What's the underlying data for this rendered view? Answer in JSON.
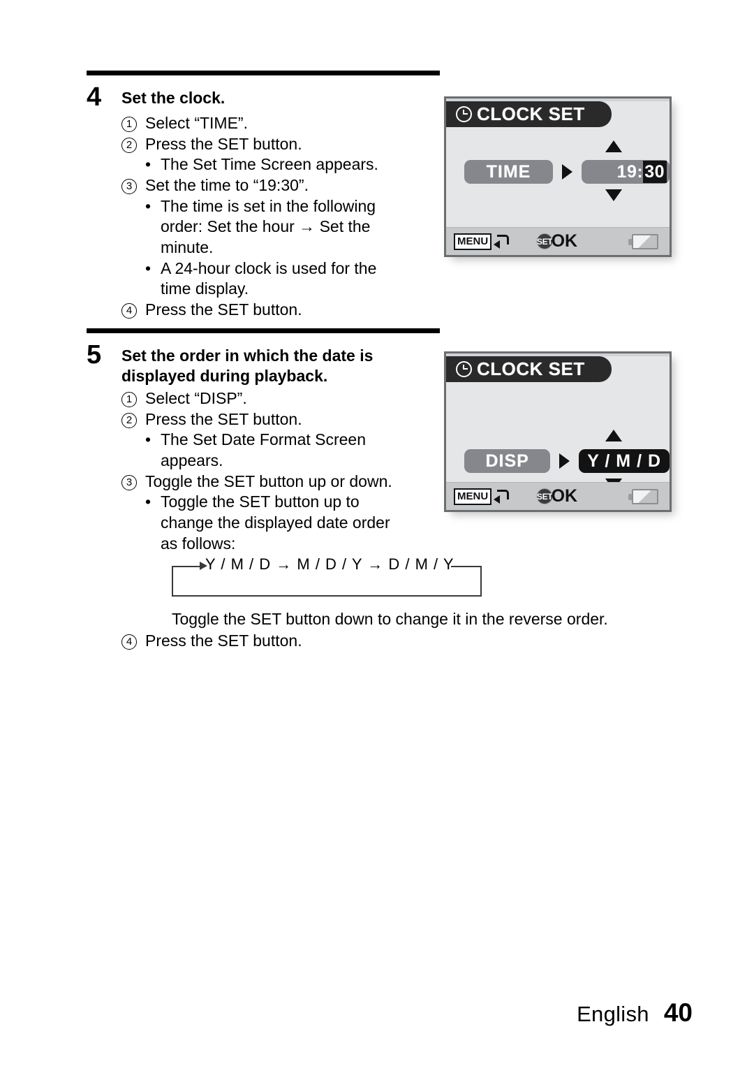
{
  "document": {
    "footer": {
      "language": "English",
      "page_number": "40"
    }
  },
  "steps": [
    {
      "number": "4",
      "title": "Set the clock.",
      "items": [
        {
          "marker": "1",
          "text": "Select “TIME”."
        },
        {
          "marker": "2",
          "text": "Press the SET button."
        },
        {
          "marker": "•",
          "text": "The Set Time Screen appears."
        },
        {
          "marker": "3",
          "text": "Set the time to “19:30”."
        },
        {
          "marker": "•",
          "text": "The time is set in the following order: Set the hour → Set the minute."
        },
        {
          "marker": "•",
          "text": "A 24-hour clock is used for the time display."
        },
        {
          "marker": "4",
          "text": "Press the SET button."
        }
      ]
    },
    {
      "number": "5",
      "title": "Set the order in which the date is displayed during playback.",
      "items": [
        {
          "marker": "1",
          "text": "Select “DISP”."
        },
        {
          "marker": "2",
          "text": "Press the SET button."
        },
        {
          "marker": "•",
          "text": "The Set Date Format Screen appears."
        },
        {
          "marker": "3",
          "text": "Toggle the SET button up or down."
        },
        {
          "marker": "•",
          "text": "Toggle the SET button up to change the displayed date order as follows:"
        }
      ],
      "cycle_diagram": {
        "sequence": "Y / M / D → M / D / Y → D / M / Y",
        "orders": [
          "Y / M / D",
          "M / D / Y",
          "D / M / Y"
        ],
        "loops": true
      },
      "trailing_note": "Toggle the SET button down to change it in the reverse order.",
      "final_item": {
        "marker": "4",
        "text": "Press the SET button."
      }
    }
  ],
  "step4_text": {
    "l1": "Select “TIME”.",
    "l2": "Press the SET button.",
    "l3": "The Set Time Screen appears.",
    "l4": "Set the time to “19:30”.",
    "l5a": "The time is set in the following",
    "l5b": "order: Set the hour → Set the",
    "l5c": "minute.",
    "l6a": "A 24-hour clock is used for the",
    "l6b": "time display.",
    "l7": "Press the SET button.",
    "m1": "1",
    "m2": "2",
    "m3": "3",
    "m4": "4",
    "bullet": "•"
  },
  "step5_text": {
    "title_a": "Set the order in which the date is",
    "title_b": "displayed during playback.",
    "l1": "Select “DISP”.",
    "l2": "Press the SET button.",
    "l3a": "The Set Date Format Screen",
    "l3b": "appears.",
    "l4": "Toggle the SET button up or down.",
    "l5a": "Toggle the SET button up to",
    "l5b": "change the displayed date order",
    "l5c": "as follows:",
    "cycle": "Y / M / D → M / D / Y → D / M / Y",
    "note": "Toggle the SET button down to change it in the reverse order.",
    "l6": "Press the SET button.",
    "m1": "1",
    "m2": "2",
    "m3": "3",
    "m4": "4",
    "bullet": "•"
  },
  "lcd_screens": [
    {
      "id": "set-time-screen",
      "title": "CLOCK SET",
      "title_icon": "clock-icon",
      "label": "TIME",
      "value_prefix": "19:",
      "value_highlight": "30",
      "value_full": "19:30",
      "value_style": "gray-pill-with-inverted-minutes",
      "status": {
        "menu_label": "MENU",
        "menu_icon": "return-arrow-icon",
        "set_badge": "SET",
        "set_action": "OK",
        "battery_icon": "battery-icon"
      }
    },
    {
      "id": "set-date-format-screen",
      "title": "CLOCK SET",
      "title_icon": "clock-icon",
      "label": "DISP",
      "value_full": "Y / M / D",
      "value_style": "black-pill",
      "status": {
        "menu_label": "MENU",
        "menu_icon": "return-arrow-icon",
        "set_badge": "SET",
        "set_action": "OK",
        "battery_icon": "battery-icon"
      }
    }
  ],
  "colors": {
    "lcd_background": "#e4e6e8",
    "lcd_border": "#6c6f72",
    "title_bar": "#2a2a2a",
    "pill_gray": "#85878c",
    "pill_black": "#131313",
    "status_bar": "#c6c8ca",
    "text": "#000000"
  }
}
